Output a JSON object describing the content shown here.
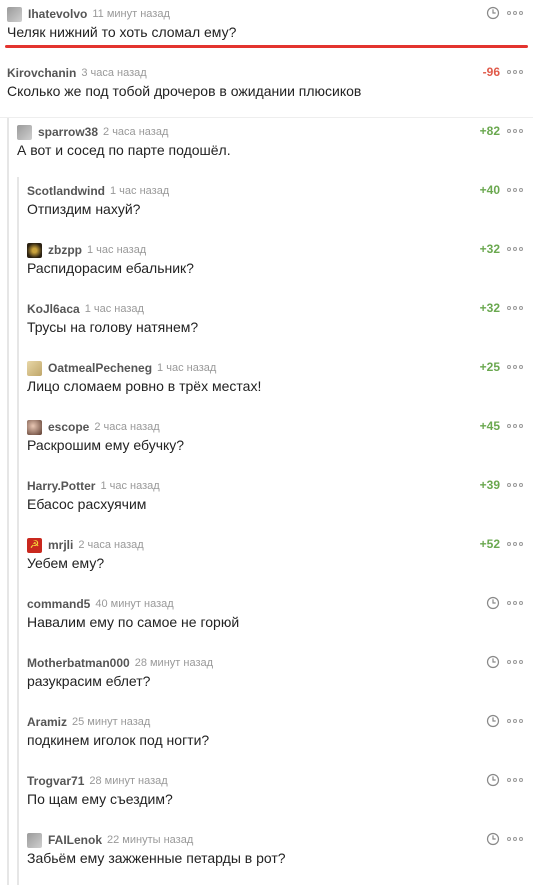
{
  "comments": [
    {
      "author": "Ihatevolvo",
      "time": "11 минут назад",
      "text": "Челяк нижний то хоть сломал ему?",
      "rating": "",
      "rating_sign": "none",
      "avatar": "gray"
    },
    {
      "author": "Kirovchanin",
      "time": "3 часа назад",
      "text": "Сколько же под тобой дрочеров в ожидании плюсиков",
      "rating": "-96",
      "rating_sign": "neg",
      "avatar": "none"
    },
    {
      "author": "sparrow38",
      "time": "2 часа назад",
      "text": "А вот и сосед по парте подошёл.",
      "rating": "+82",
      "rating_sign": "pos",
      "avatar": "gray"
    },
    {
      "author": "Scotlandwind",
      "time": "1 час назад",
      "text": "Отпиздим нахуй?",
      "rating": "+40",
      "rating_sign": "pos",
      "avatar": "none"
    },
    {
      "author": "zbzpp",
      "time": "1 час назад",
      "text": "Распидорасим ебальник?",
      "rating": "+32",
      "rating_sign": "pos",
      "avatar": "dark"
    },
    {
      "author": "KoJl6aca",
      "time": "1 час назад",
      "text": "Трусы на голову натянем?",
      "rating": "+32",
      "rating_sign": "pos",
      "avatar": "none"
    },
    {
      "author": "OatmealPecheneg",
      "time": "1 час назад",
      "text": "Лицо сломаем ровно в трёх местах!",
      "rating": "+25",
      "rating_sign": "pos",
      "avatar": "tan"
    },
    {
      "author": "escope",
      "time": "2 часа назад",
      "text": "Раскрошим ему ебучку?",
      "rating": "+45",
      "rating_sign": "pos",
      "avatar": "face"
    },
    {
      "author": "Harry.Potter",
      "time": "1 час назад",
      "text": "Ебасос расхуячим",
      "rating": "+39",
      "rating_sign": "pos",
      "avatar": "none"
    },
    {
      "author": "mrjli",
      "time": "2 часа назад",
      "text": "Уебем ему?",
      "rating": "+52",
      "rating_sign": "pos",
      "avatar": "red"
    },
    {
      "author": "command5",
      "time": "40 минут назад",
      "text": "Навалим ему по самое не горюй",
      "rating": "",
      "rating_sign": "none",
      "avatar": "none"
    },
    {
      "author": "Motherbatman000",
      "time": "28 минут назад",
      "text": "разукрасим еблет?",
      "rating": "",
      "rating_sign": "none",
      "avatar": "none"
    },
    {
      "author": "Aramiz",
      "time": "25 минут назад",
      "text": "подкинем иголок под ногти?",
      "rating": "",
      "rating_sign": "none",
      "avatar": "none"
    },
    {
      "author": "Trogvar71",
      "time": "28 минут назад",
      "text": "По щам ему съездим?",
      "rating": "",
      "rating_sign": "none",
      "avatar": "none"
    },
    {
      "author": "FAILenok",
      "time": "22 минуты назад",
      "text": "Забьём ему зажженные петарды в рот?",
      "rating": "",
      "rating_sign": "none",
      "avatar": "gray"
    }
  ],
  "colors": {
    "accent_red": "#e3342f",
    "rating_positive": "#6aa84f",
    "rating_negative": "#e05a4a",
    "author": "#555555",
    "time": "#999999"
  },
  "icons": {
    "clock": "clock-icon",
    "more": "more-dots-icon"
  }
}
